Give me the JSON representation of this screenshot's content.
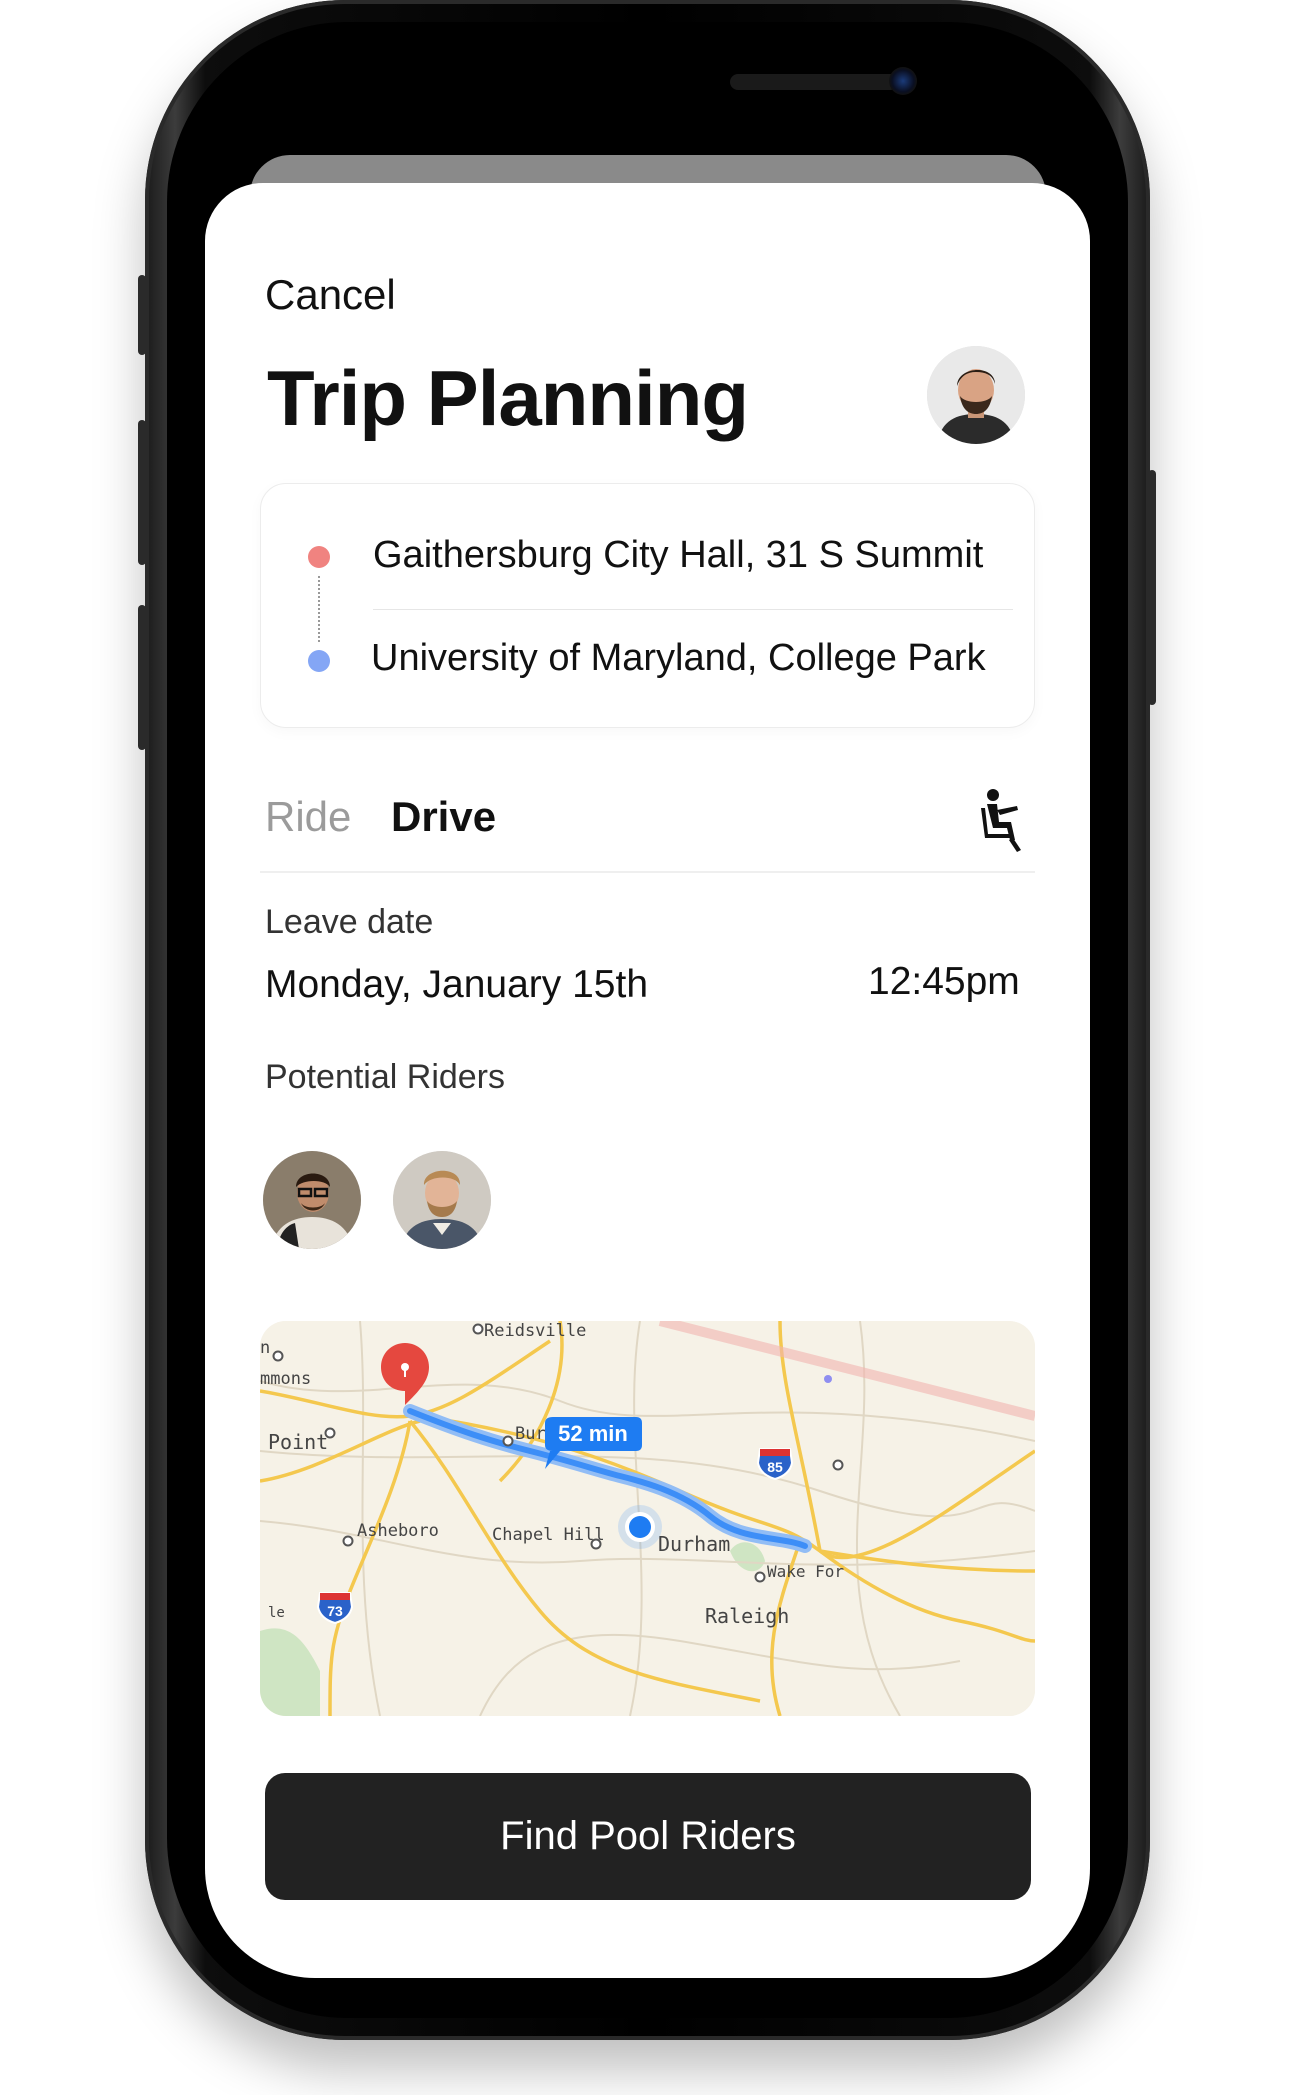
{
  "header": {
    "cancel_label": "Cancel",
    "title": "Trip Planning"
  },
  "route": {
    "origin": "Gaithersburg City Hall, 31 S Summit",
    "destination": "University of Maryland, College Park"
  },
  "mode_tabs": [
    {
      "label": "Ride",
      "active": false
    },
    {
      "label": "Drive",
      "active": true
    }
  ],
  "leave": {
    "label": "Leave date",
    "date": "Monday, January 15th",
    "time": "12:45pm"
  },
  "riders": {
    "label": "Potential Riders"
  },
  "map": {
    "duration": "52 min",
    "places": [
      "Reidsville",
      "mmons",
      "Point",
      "Bur",
      "Asheboro",
      "Chapel Hill",
      "Durham",
      "Wake For",
      "Raleigh",
      "n",
      "le"
    ],
    "highway_shields": [
      "85",
      "73"
    ]
  },
  "cta_label": "Find Pool Riders",
  "colors": {
    "origin_dot": "#f08380",
    "destination_dot": "#84a6f5",
    "route_line": "#3d8ef7",
    "pin": "#e5483f",
    "cta_bg": "#222222"
  },
  "icons": {
    "seat": "person-in-seat-icon",
    "pin": "map-pin-icon",
    "location": "current-location-icon"
  }
}
